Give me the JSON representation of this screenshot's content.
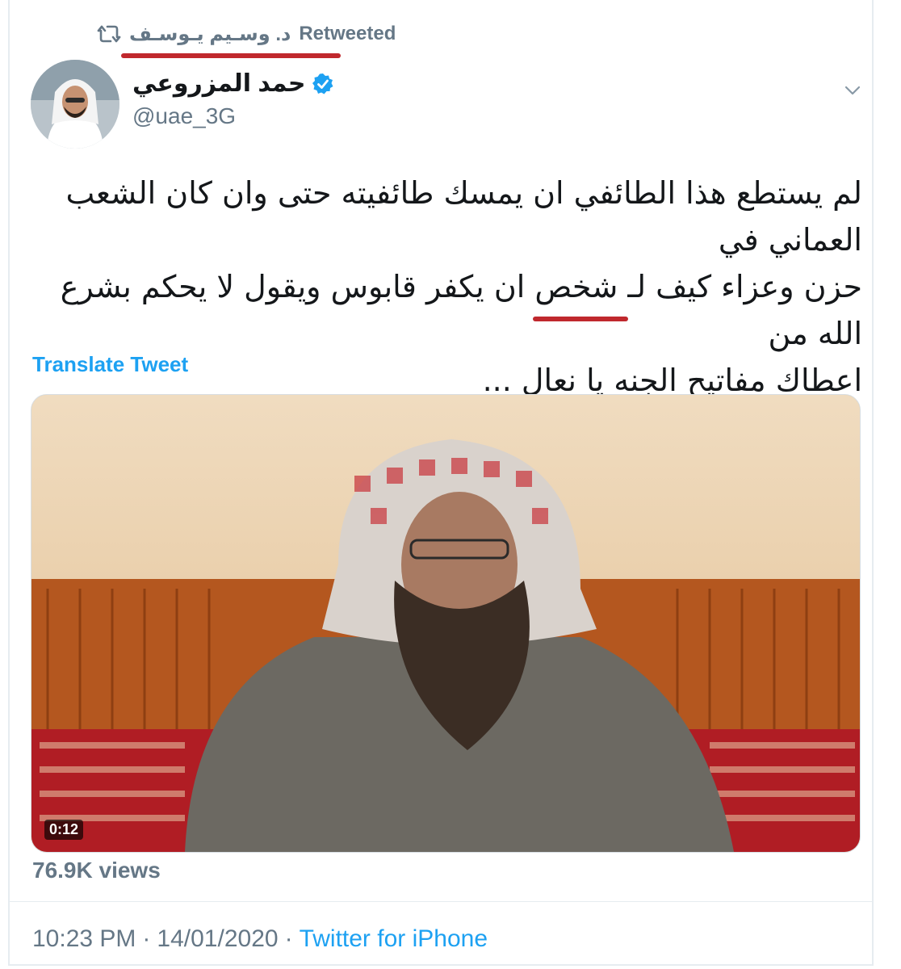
{
  "retweet_header": {
    "icon": "retweet-icon",
    "retweeter_name": "د. وسـيم يـوسـف",
    "label": "Retweeted"
  },
  "author": {
    "display_name": "حمد المزروعي",
    "handle": "@uae_3G",
    "verified_icon": "verified-badge-icon",
    "avatar": "avatar-photo"
  },
  "menu_icon": "chevron-down-icon",
  "tweet": {
    "line1": "لم يستطع هذا الطائفي ان يمسك طائفيته  حتى وان كان الشعب العماني في",
    "line2": "حزن وعزاء كيف لـ شخص ان يكفر قابوس ويقول لا يحكم بشرع الله من",
    "line3": "اعطاك مفاتيح الجنه يا نعال ..."
  },
  "translate_label": "Translate Tweet",
  "media": {
    "type": "video",
    "duration": "0:12",
    "views": "76.9K views"
  },
  "footer": {
    "time": "10:23 PM",
    "separator1": "·",
    "date": "14/01/2020",
    "separator2": "·",
    "source": "Twitter for iPhone"
  },
  "colors": {
    "link": "#1da1f2",
    "secondary_text": "#657786",
    "annotation_red": "#c0282d"
  }
}
